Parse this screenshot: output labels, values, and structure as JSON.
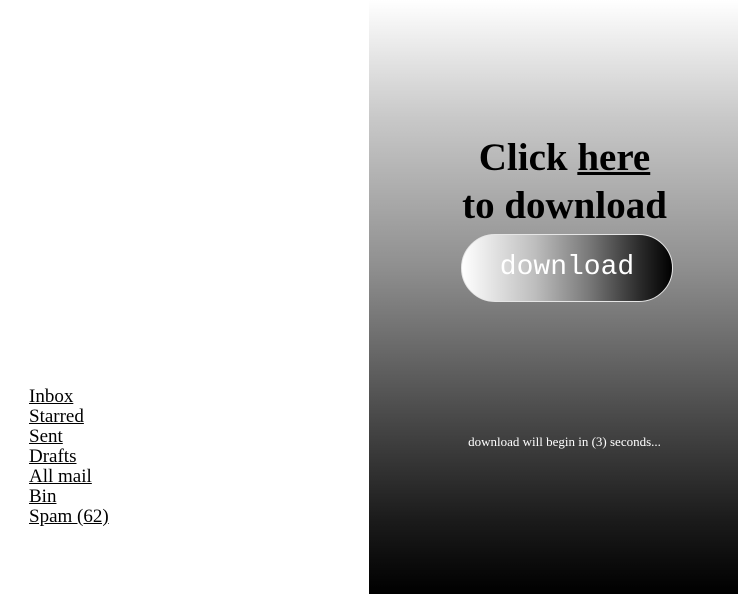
{
  "nav": {
    "items": [
      {
        "label": "Inbox"
      },
      {
        "label": "Starred"
      },
      {
        "label": "Sent"
      },
      {
        "label": "Drafts"
      },
      {
        "label": "All mail"
      },
      {
        "label": "Bin"
      },
      {
        "label": "Spam (62)"
      }
    ]
  },
  "promo": {
    "headline_prefix": "Click ",
    "headline_link": "here",
    "headline_suffix": "to download",
    "button_label": "download",
    "countdown_text": "download will begin in (3) seconds..."
  },
  "colors": {
    "gradient_top": "#ffffff",
    "gradient_bottom": "#000000",
    "text": "#000000",
    "countdown_text": "#ffffff"
  }
}
